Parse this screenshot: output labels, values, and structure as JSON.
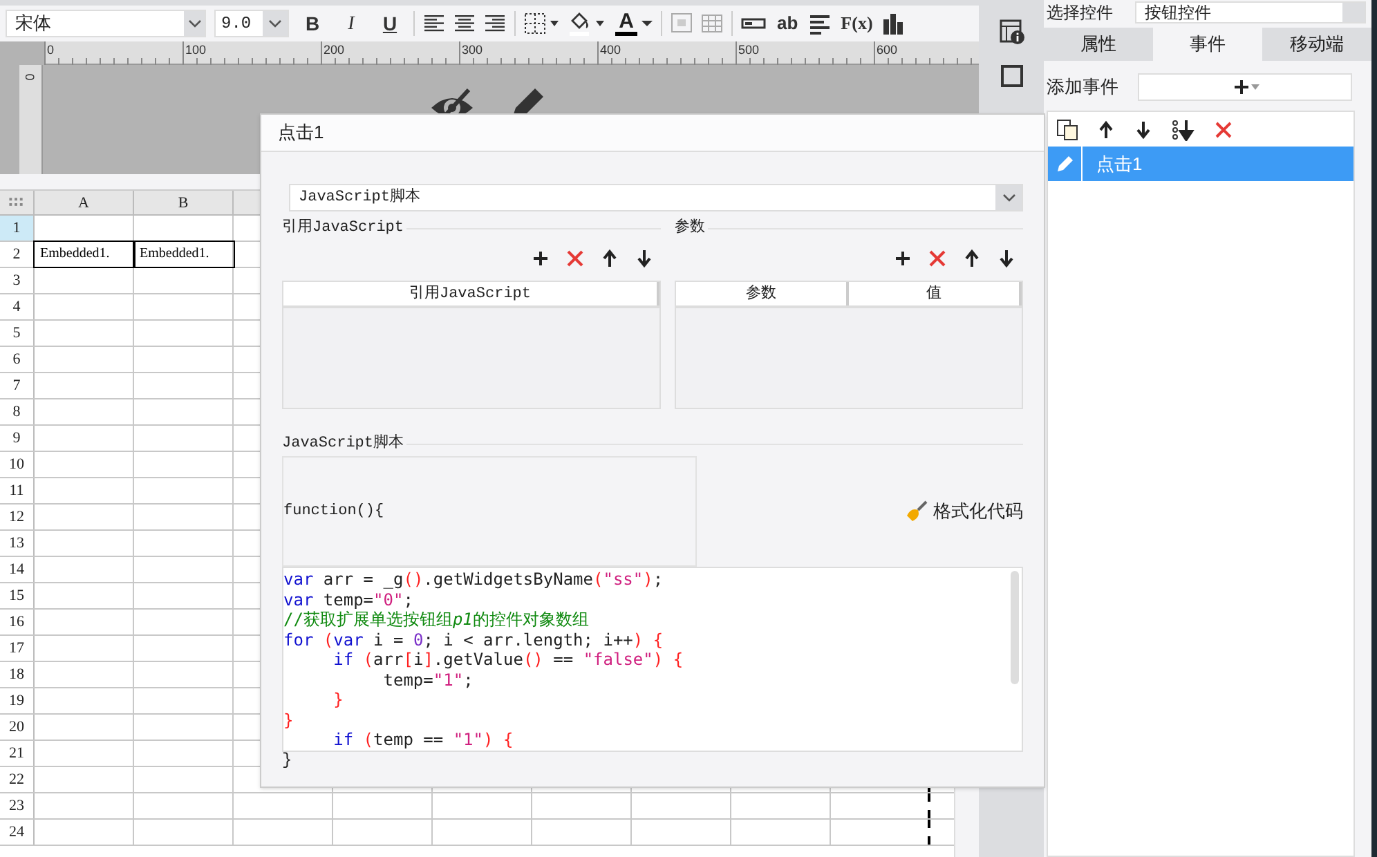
{
  "toolbar": {
    "font": "宋体",
    "size": "9.0",
    "format_buttons": [
      "B",
      "I",
      "U"
    ],
    "font_color_label": "A",
    "text_buttons": [
      "ab",
      "F(x)"
    ]
  },
  "ruler": {
    "marks": [
      "0",
      "100",
      "200",
      "300",
      "400",
      "500",
      "600"
    ],
    "vertical_mark": "0"
  },
  "sheet": {
    "columns": [
      "A",
      "B"
    ],
    "rows": [
      {
        "label": "1",
        "selected": true,
        "cells": []
      },
      {
        "label": "2",
        "selected": false,
        "cells": [
          "Embedded1.",
          "Embedded1."
        ]
      },
      {
        "label": "3",
        "selected": false,
        "cells": []
      },
      {
        "label": "4",
        "selected": false,
        "cells": []
      },
      {
        "label": "5",
        "selected": false,
        "cells": []
      },
      {
        "label": "6",
        "selected": false,
        "cells": []
      },
      {
        "label": "7",
        "selected": false,
        "cells": []
      },
      {
        "label": "8",
        "selected": false,
        "cells": []
      },
      {
        "label": "9",
        "selected": false,
        "cells": []
      },
      {
        "label": "10",
        "selected": false,
        "cells": []
      },
      {
        "label": "11",
        "selected": false,
        "cells": []
      },
      {
        "label": "12",
        "selected": false,
        "cells": []
      },
      {
        "label": "13",
        "selected": false,
        "cells": []
      },
      {
        "label": "14",
        "selected": false,
        "cells": []
      },
      {
        "label": "15",
        "selected": false,
        "cells": []
      },
      {
        "label": "16",
        "selected": false,
        "cells": []
      },
      {
        "label": "17",
        "selected": false,
        "cells": []
      },
      {
        "label": "18",
        "selected": false,
        "cells": []
      },
      {
        "label": "19",
        "selected": false,
        "cells": []
      },
      {
        "label": "20",
        "selected": false,
        "cells": []
      },
      {
        "label": "21",
        "selected": false,
        "cells": []
      },
      {
        "label": "22",
        "selected": false,
        "cells": []
      },
      {
        "label": "23",
        "selected": false,
        "cells": []
      },
      {
        "label": "24",
        "selected": false,
        "cells": []
      }
    ]
  },
  "right_panel": {
    "select_label": "选择控件",
    "select_value": "按钮控件",
    "tabs": [
      {
        "label": "属性",
        "selected": false
      },
      {
        "label": "事件",
        "selected": true
      },
      {
        "label": "移动端",
        "selected": false
      }
    ],
    "add_event_label": "添加事件",
    "events": [
      {
        "label": "点击1",
        "selected": true
      }
    ]
  },
  "dialog": {
    "title": "点击1",
    "type_select": "JavaScript脚本",
    "ref_section": {
      "title": "引用JavaScript",
      "columns": [
        "引用JavaScript"
      ]
    },
    "param_section": {
      "title": "参数",
      "columns": [
        "参数",
        "值"
      ]
    },
    "script_section": {
      "title": "JavaScript脚本",
      "header": "function(){",
      "format_button": "格式化代码",
      "footer": "}",
      "code": [
        [
          {
            "kind": "keyword",
            "text": "var"
          },
          {
            "kind": "plain",
            "text": " arr = _g"
          },
          {
            "kind": "bracket",
            "text": "()"
          },
          {
            "kind": "plain",
            "text": ".getWidgetsByName"
          },
          {
            "kind": "bracket",
            "text": "("
          },
          {
            "kind": "string",
            "text": "\"ss\""
          },
          {
            "kind": "bracket",
            "text": ")"
          },
          {
            "kind": "plain",
            "text": ";"
          }
        ],
        [
          {
            "kind": "keyword",
            "text": "var"
          },
          {
            "kind": "plain",
            "text": " temp="
          },
          {
            "kind": "string",
            "text": "\"0\""
          },
          {
            "kind": "plain",
            "text": ";"
          }
        ],
        [
          {
            "kind": "comment",
            "text": "//获取扩展单选按钮组"
          },
          {
            "kind": "comment_italic",
            "text": "p1"
          },
          {
            "kind": "comment",
            "text": "的控件对象数组"
          }
        ],
        [
          {
            "kind": "keyword",
            "text": "for "
          },
          {
            "kind": "bracket",
            "text": "("
          },
          {
            "kind": "keyword",
            "text": "var"
          },
          {
            "kind": "plain",
            "text": " i = "
          },
          {
            "kind": "number",
            "text": "0"
          },
          {
            "kind": "plain",
            "text": "; i < arr.length; i++"
          },
          {
            "kind": "bracket",
            "text": ") {"
          }
        ],
        [
          {
            "kind": "keyword",
            "text": "     if "
          },
          {
            "kind": "bracket",
            "text": "("
          },
          {
            "kind": "plain",
            "text": "arr"
          },
          {
            "kind": "bracket",
            "text": "["
          },
          {
            "kind": "plain",
            "text": "i"
          },
          {
            "kind": "bracket",
            "text": "]"
          },
          {
            "kind": "plain",
            "text": ".getValue"
          },
          {
            "kind": "bracket",
            "text": "()"
          },
          {
            "kind": "plain",
            "text": " == "
          },
          {
            "kind": "string",
            "text": "\"false\""
          },
          {
            "kind": "bracket",
            "text": ") {"
          }
        ],
        [
          {
            "kind": "plain",
            "text": "          temp="
          },
          {
            "kind": "string",
            "text": "\"1\""
          },
          {
            "kind": "plain",
            "text": ";"
          }
        ],
        [
          {
            "kind": "bracket",
            "text": "     }"
          }
        ],
        [
          {
            "kind": "bracket",
            "text": "}"
          }
        ],
        [
          {
            "kind": "keyword",
            "text": "     if "
          },
          {
            "kind": "bracket",
            "text": "("
          },
          {
            "kind": "plain",
            "text": "temp == "
          },
          {
            "kind": "string",
            "text": "\"1\""
          },
          {
            "kind": "bracket",
            "text": ") {"
          }
        ]
      ]
    }
  }
}
